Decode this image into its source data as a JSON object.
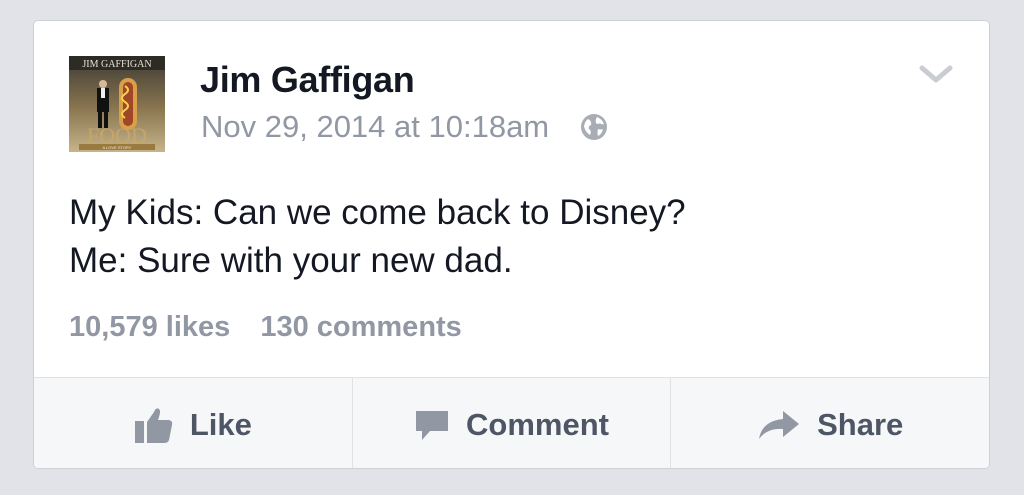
{
  "post": {
    "author": "Jim Gaffigan",
    "timestamp": "Nov 29, 2014 at 10:18am",
    "privacy_icon": "globe-icon",
    "avatar": {
      "top_text": "JIM GAFFIGAN",
      "bottom_text": "FOOD",
      "subtitle": "A LOVE STORY"
    },
    "body_lines": [
      "My Kids: Can we come back to Disney?",
      "Me: Sure with your new dad."
    ],
    "likes": "10,579 likes",
    "comments": "130 comments"
  },
  "actions": {
    "like_label": "Like",
    "comment_label": "Comment",
    "share_label": "Share"
  },
  "colors": {
    "background": "#e2e3e8",
    "text": "#141823",
    "muted": "#9197a3",
    "action_text": "#4e5665"
  }
}
